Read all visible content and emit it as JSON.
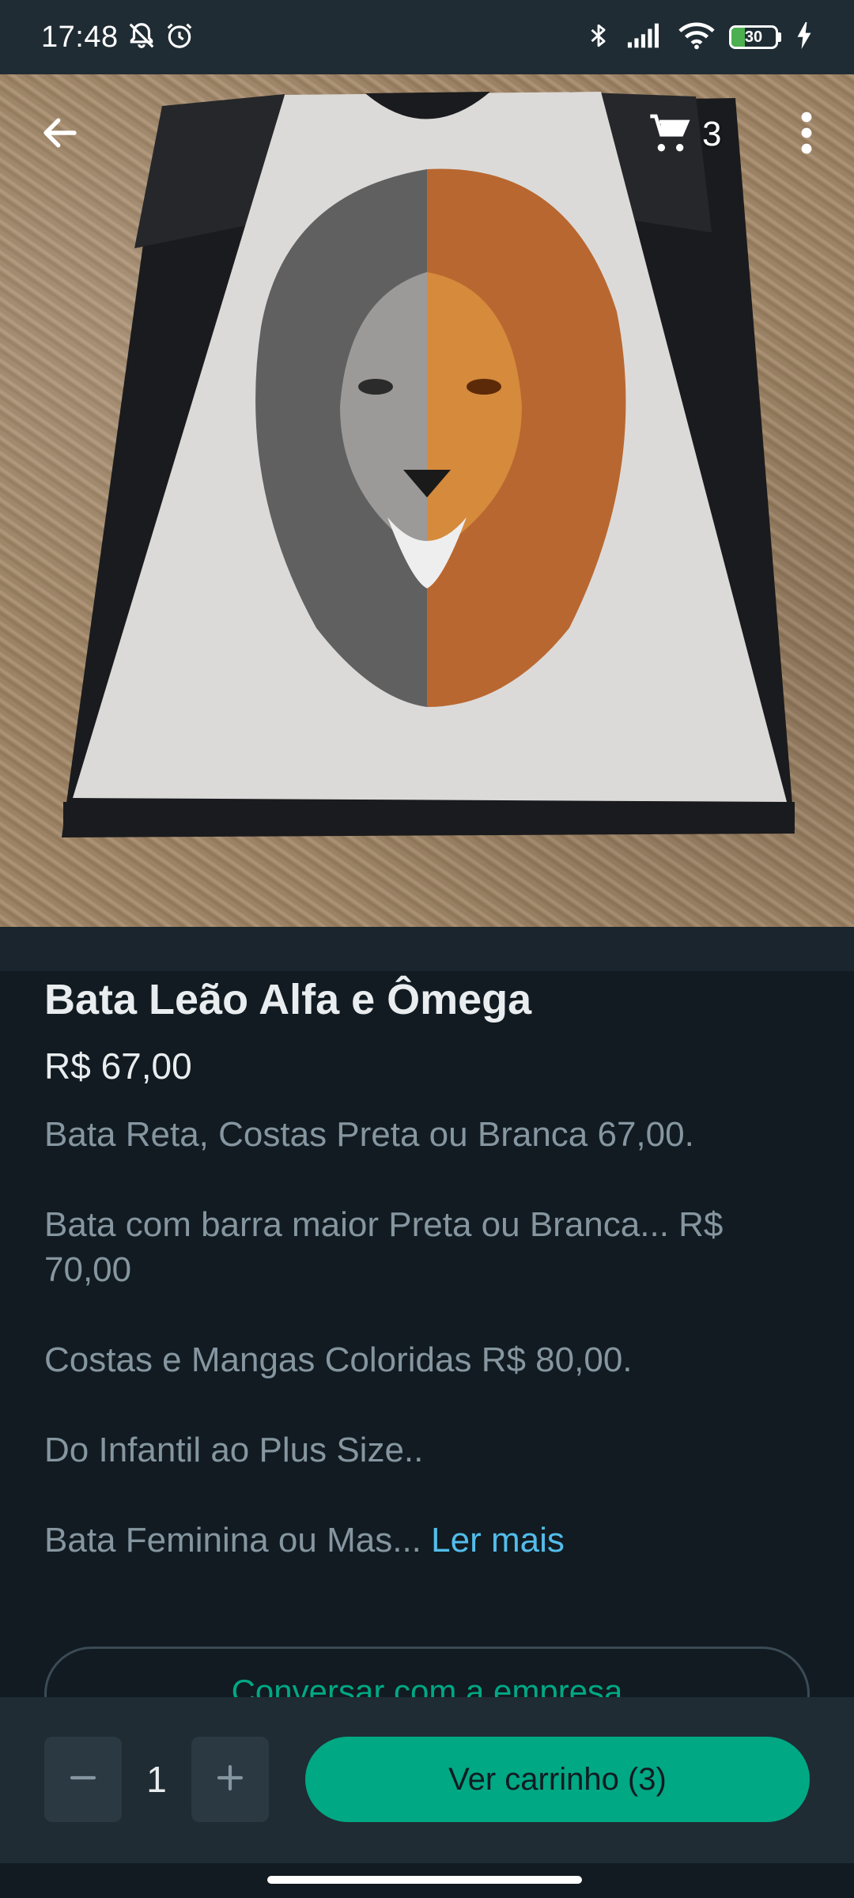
{
  "status_bar": {
    "time": "17:48",
    "battery_level": "30",
    "battery_fraction": 0.3,
    "icons": [
      "notifications-off-icon",
      "alarm-icon",
      "bluetooth-icon",
      "signal-icon",
      "wifi-icon",
      "battery-icon",
      "charging-icon"
    ]
  },
  "header": {
    "back_icon": "arrow-left-icon",
    "cart_icon": "cart-icon",
    "cart_count": "3",
    "menu_icon": "more-vert-icon"
  },
  "product": {
    "title": "Bata Leão Alfa e Ômega",
    "price": "R$ 67,00",
    "description": {
      "line1": "Bata Reta, Costas Preta ou Branca 67,00.",
      "line2": "Bata com barra maior Preta ou Branca... R$ 70,00",
      "line3": "Costas e Mangas Coloridas R$ 80,00.",
      "line4": "Do Infantil ao Plus Size..",
      "line5": "Bata Feminina ou Mas... ",
      "read_more": "Ler mais"
    }
  },
  "actions": {
    "chat_button": "Conversar com a empresa",
    "quantity": "1",
    "view_cart": "Ver carrinho (3)"
  },
  "colors": {
    "background": "#111b21",
    "accent": "#00a884",
    "link": "#53bdeb",
    "muted_text": "#8696a0"
  }
}
